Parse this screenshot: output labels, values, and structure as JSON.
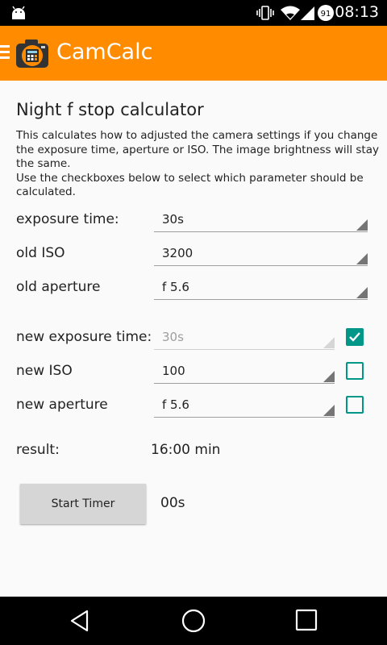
{
  "status_bar": {
    "time": "08:13",
    "battery_level": "91",
    "icons": [
      "android-debug-icon",
      "vibrate-icon",
      "wifi-icon",
      "signal-icon",
      "battery-icon"
    ]
  },
  "app_bar": {
    "title": "CamCalc",
    "menu_icon": "hamburger-menu-icon",
    "logo_icon": "camera-calculator-logo-icon",
    "color": "#ff8c00"
  },
  "main": {
    "heading": "Night f stop calculator",
    "description_1": "This calculates how to adjusted the camera settings if you change the exposure time, aperture or ISO. The image brightness will stay the same.",
    "description_2": "Use the checkboxes below to select which parameter should be calculated.",
    "old_settings": {
      "exposure_time": {
        "label": "exposure time:",
        "value": "30s"
      },
      "iso": {
        "label": "old ISO",
        "value": "3200"
      },
      "aperture": {
        "label": "old aperture",
        "value": "f 5.6"
      }
    },
    "new_settings": {
      "exposure_time": {
        "label": "new exposure time:",
        "value": "30s",
        "checked": true,
        "enabled": false
      },
      "iso": {
        "label": "new ISO",
        "value": "100",
        "checked": false,
        "enabled": true
      },
      "aperture": {
        "label": "new aperture",
        "value": "f 5.6",
        "checked": false,
        "enabled": true
      }
    },
    "result": {
      "label": "result:",
      "value": "16:00 min"
    },
    "timer": {
      "button_label": "Start Timer",
      "value": "00s"
    },
    "accent_color": "#009688"
  },
  "nav_bar": {
    "icons": [
      "back-icon",
      "home-icon",
      "recents-icon"
    ]
  }
}
